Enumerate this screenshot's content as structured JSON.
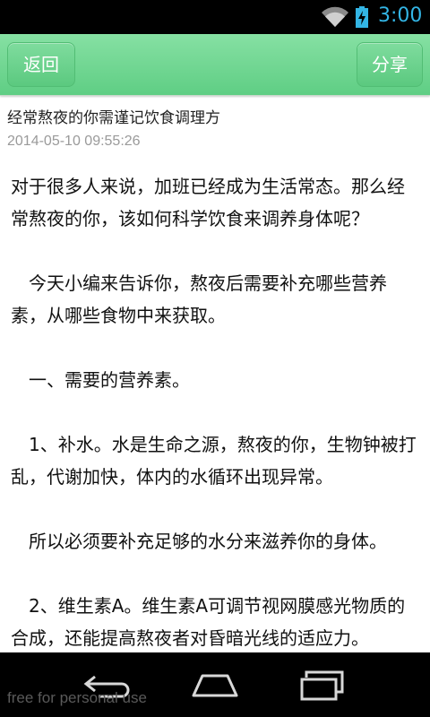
{
  "status_bar": {
    "time": "3:00",
    "icons": [
      "wifi-icon",
      "battery-icon"
    ],
    "accent_color": "#33b5e5"
  },
  "top_bar": {
    "back_label": "返回",
    "share_label": "分享",
    "color": "#5fce84"
  },
  "article": {
    "title": "经常熬夜的你需谨记饮食调理方",
    "date": "2014-05-10 09:55:26",
    "paragraphs": [
      "对于很多人来说，加班已经成为生活常态。那么经常熬夜的你，该如何科学饮食来调养身体呢？",
      "　今天小编来告诉你，熬夜后需要补充哪些营养素，从哪些食物中来获取。",
      "　一、需要的营养素。",
      "　1、补水。水是生命之源，熬夜的你，生物钟被打乱，代谢加快，体内的水循环出现异常。",
      "　所以必须要补充足够的水分来滋养你的身体。",
      "　2、维生素A。维生素A可调节视网膜感光物质的合成，还能提高熬夜者对昏暗光线的适应力。"
    ]
  },
  "nav_bar": {
    "icons": [
      "back-icon",
      "home-icon",
      "recent-apps-icon"
    ]
  },
  "watermark": "free for personal use"
}
